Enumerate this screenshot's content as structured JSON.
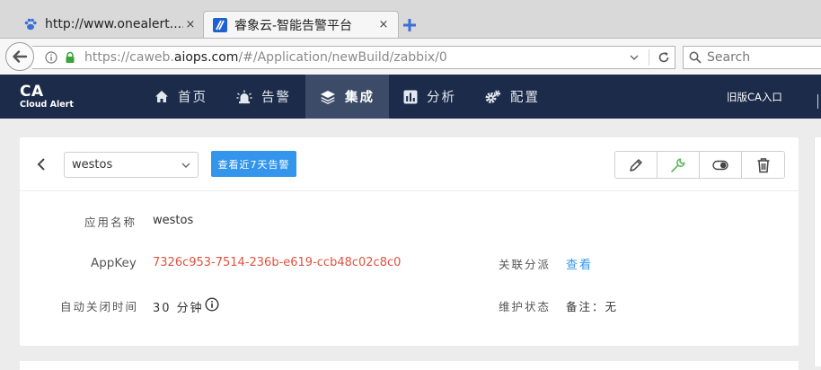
{
  "browser": {
    "tabs": [
      {
        "title": "http://www.onealert....",
        "close": "×"
      },
      {
        "title": "睿象云-智能告警平台",
        "close": "×"
      }
    ],
    "url_prefix": "https://caweb.",
    "url_host": "aiops.com",
    "url_path": "/#/Application/newBuild/zabbix/0",
    "search_placeholder": "Search"
  },
  "app": {
    "logo_main": "CA",
    "logo_sub": "Cloud Alert",
    "nav": [
      {
        "label": "首页",
        "icon": "home-icon"
      },
      {
        "label": "告警",
        "icon": "alarm-light-icon"
      },
      {
        "label": "集成",
        "icon": "layers-icon"
      },
      {
        "label": "分析",
        "icon": "bar-chart-icon"
      },
      {
        "label": "配置",
        "icon": "gear-icon"
      }
    ],
    "active_nav": "集成",
    "old_version": "旧版CA入口"
  },
  "toolbar": {
    "selected_app": "westos",
    "recent_alerts_button": "查看近7天告警",
    "icons": [
      "pencil-icon",
      "wrench-icon",
      "toggle-icon",
      "trash-icon"
    ],
    "accent": "#3396ec"
  },
  "details": {
    "app_name_label": "应用名称",
    "app_name_value": "westos",
    "appkey_label": "AppKey",
    "appkey_value": "7326c953-7514-236b-e619-ccb48c02c8c0",
    "auto_close_label": "自动关闭时间",
    "auto_close_value": "30 分钟",
    "linked_label": "关联分派",
    "linked_value": "查看",
    "maintenance_label": "维护状态",
    "maintenance_value": "备注：无"
  },
  "colors": {
    "header_bg": "#1c2b49",
    "header_active": "#3c4b67",
    "appkey_red": "#e0533f"
  }
}
